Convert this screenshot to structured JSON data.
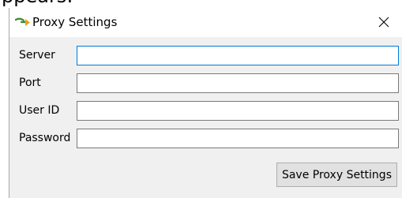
{
  "top_fragment": "ppears:",
  "window": {
    "title": "Proxy Settings",
    "icon": "proxy-arrow-icon",
    "close_glyph": "✕"
  },
  "fields": [
    {
      "label": "Server",
      "value": "",
      "focused": true
    },
    {
      "label": "Port",
      "value": ""
    },
    {
      "label": "User ID",
      "value": ""
    },
    {
      "label": "Password",
      "value": ""
    }
  ],
  "buttons": {
    "save_label": "Save Proxy Settings"
  },
  "colors": {
    "title_bar": "#ffffff",
    "window_body": "#f0f0f0",
    "focus_border": "#0078d7",
    "input_border": "#7a7a7a",
    "button_bg": "#e1e1e1",
    "icon_green": "#3a8a2a",
    "icon_orange": "#e8a020"
  }
}
